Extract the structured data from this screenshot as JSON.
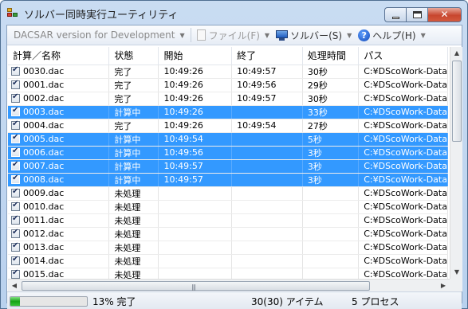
{
  "window": {
    "title": "ソルバー同時実行ユーティリティ"
  },
  "toolbar": {
    "dacsar": "DACSAR version for Development",
    "file": "ファイル(F)",
    "solver": "ソルバー(S)",
    "help": "ヘルプ(H)"
  },
  "columns": [
    "計算／名称",
    "状態",
    "開始",
    "終了",
    "処理時間",
    "パス"
  ],
  "rows": [
    {
      "name": "0030.dac",
      "status": "完了",
      "start": "10:49:26",
      "end": "10:49:57",
      "time": "30秒",
      "path": "C:¥DScoWork-Data",
      "selected": false
    },
    {
      "name": "0001.dac",
      "status": "完了",
      "start": "10:49:26",
      "end": "10:49:56",
      "time": "29秒",
      "path": "C:¥DScoWork-Data",
      "selected": false
    },
    {
      "name": "0002.dac",
      "status": "完了",
      "start": "10:49:26",
      "end": "10:49:57",
      "time": "30秒",
      "path": "C:¥DScoWork-Data",
      "selected": false
    },
    {
      "name": "0003.dac",
      "status": "計算中",
      "start": "10:49:26",
      "end": "",
      "time": "33秒",
      "path": "C:¥DScoWork-Data",
      "selected": true
    },
    {
      "name": "0004.dac",
      "status": "完了",
      "start": "10:49:26",
      "end": "10:49:54",
      "time": "27秒",
      "path": "C:¥DScoWork-Data",
      "selected": false
    },
    {
      "name": "0005.dac",
      "status": "計算中",
      "start": "10:49:54",
      "end": "",
      "time": "5秒",
      "path": "C:¥DScoWork-Data",
      "selected": true
    },
    {
      "name": "0006.dac",
      "status": "計算中",
      "start": "10:49:56",
      "end": "",
      "time": "3秒",
      "path": "C:¥DScoWork-Data",
      "selected": true
    },
    {
      "name": "0007.dac",
      "status": "計算中",
      "start": "10:49:57",
      "end": "",
      "time": "3秒",
      "path": "C:¥DScoWork-Data",
      "selected": true
    },
    {
      "name": "0008.dac",
      "status": "計算中",
      "start": "10:49:57",
      "end": "",
      "time": "3秒",
      "path": "C:¥DScoWork-Data",
      "selected": true
    },
    {
      "name": "0009.dac",
      "status": "未処理",
      "start": "",
      "end": "",
      "time": "",
      "path": "C:¥DScoWork-Data",
      "selected": false
    },
    {
      "name": "0010.dac",
      "status": "未処理",
      "start": "",
      "end": "",
      "time": "",
      "path": "C:¥DScoWork-Data",
      "selected": false
    },
    {
      "name": "0011.dac",
      "status": "未処理",
      "start": "",
      "end": "",
      "time": "",
      "path": "C:¥DScoWork-Data",
      "selected": false
    },
    {
      "name": "0012.dac",
      "status": "未処理",
      "start": "",
      "end": "",
      "time": "",
      "path": "C:¥DScoWork-Data",
      "selected": false
    },
    {
      "name": "0013.dac",
      "status": "未処理",
      "start": "",
      "end": "",
      "time": "",
      "path": "C:¥DScoWork-Data",
      "selected": false
    },
    {
      "name": "0014.dac",
      "status": "未処理",
      "start": "",
      "end": "",
      "time": "",
      "path": "C:¥DScoWork-Data",
      "selected": false
    },
    {
      "name": "0015.dac",
      "status": "未処理",
      "start": "",
      "end": "",
      "time": "",
      "path": "C:¥DScoWork-Data",
      "selected": false
    }
  ],
  "status": {
    "progress_fraction": 0.13,
    "percent_text": "13% 完了",
    "items_text": "30(30) アイテム",
    "procs_text": "5 プロセス"
  },
  "colors": {
    "selection": "#3399ff",
    "progress": "#16a316"
  }
}
